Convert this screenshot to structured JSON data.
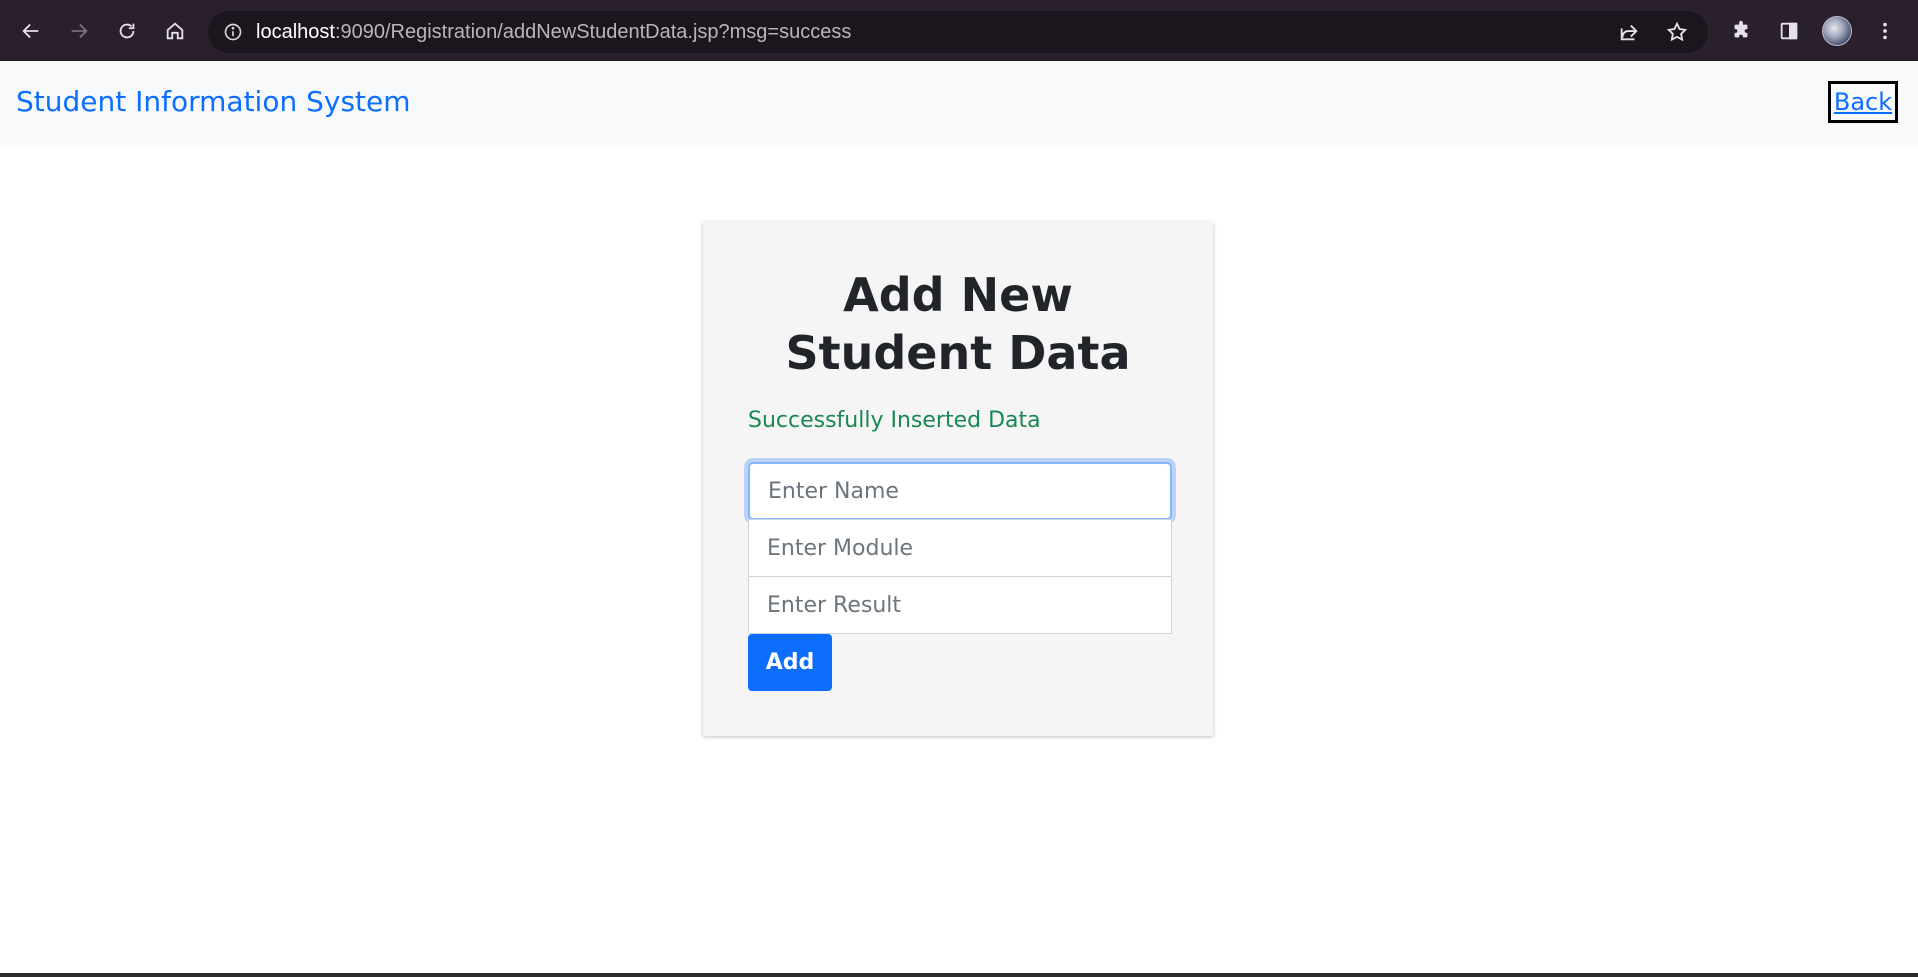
{
  "browser": {
    "url_host": "localhost",
    "url_rest": ":9090/Registration/addNewStudentData.jsp?msg=success",
    "theme_color": "#2a1f2c",
    "icons": [
      "back-arrow-icon",
      "forward-arrow-icon",
      "reload-icon",
      "home-icon",
      "site-info-icon",
      "share-icon",
      "star-icon",
      "extensions-icon",
      "side-panel-icon",
      "profile-avatar",
      "more-menu-icon"
    ]
  },
  "navbar": {
    "brand": "Student Information System",
    "back_label": "Back"
  },
  "form": {
    "title": "Add New Student Data",
    "success_message": "Successfully Inserted Data",
    "name_placeholder": "Enter Name",
    "module_placeholder": "Enter Module",
    "result_placeholder": "Enter Result",
    "add_label": "Add"
  },
  "colors": {
    "accent": "#0d6efd",
    "success": "#198754",
    "card_bg": "#f5f5f5",
    "navbar_bg": "#f8f9fa"
  }
}
